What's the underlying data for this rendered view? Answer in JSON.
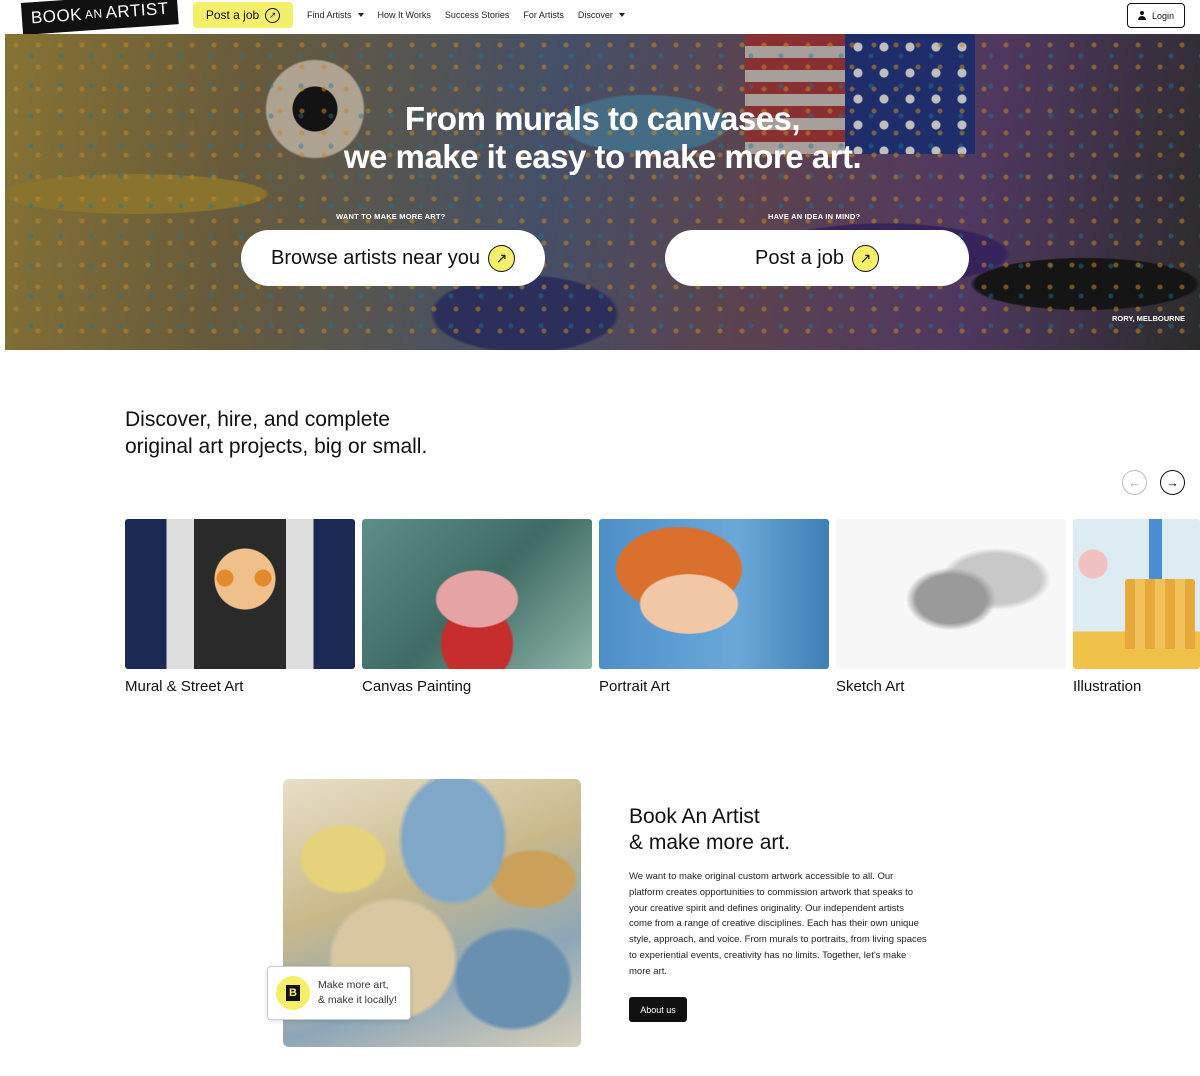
{
  "nav": {
    "logo": {
      "part1": "BOOK",
      "part2": "AN",
      "part3": "ARTIST"
    },
    "post_job": "Post a job",
    "menu": [
      {
        "label": "Find Artists",
        "dropdown": true
      },
      {
        "label": "How It Works",
        "dropdown": false
      },
      {
        "label": "Success Stories",
        "dropdown": false
      },
      {
        "label": "For Artists",
        "dropdown": false
      },
      {
        "label": "Discover",
        "dropdown": true
      }
    ],
    "login": "Login"
  },
  "hero": {
    "title_line1": "From murals to canvases,",
    "title_line2": "we make it easy to make more art.",
    "left_label": "WANT TO MAKE MORE ART?",
    "left_button": "Browse artists near you",
    "right_label": "HAVE AN IDEA IN MIND?",
    "right_button": "Post a job",
    "credit": "RORY, MELBOURNE"
  },
  "discover": {
    "title_line1": "Discover, hire, and complete",
    "title_line2": "original art projects, big or small.",
    "categories": [
      {
        "label": "Mural & Street Art"
      },
      {
        "label": "Canvas Painting"
      },
      {
        "label": "Portrait Art"
      },
      {
        "label": "Sketch Art"
      },
      {
        "label": "Illustration"
      }
    ]
  },
  "about": {
    "badge_logo": "B",
    "badge_line1": "Make more art,",
    "badge_line2": "& make it locally!",
    "title_line1": "Book An Artist",
    "title_line2": "& make more art.",
    "body": "We want to make original custom artwork accessible to all. Our platform creates opportunities to commission artwork that speaks to your creative spirit and defines originality. Our independent artists come from a range of creative disciplines. Each has their own unique style, approach, and voice. From murals to portraits, from living spaces to experiential events, creativity has no limits. Together, let's make more art.",
    "button": "About us"
  },
  "colors": {
    "accent_yellow": "#f4ef6b",
    "dark": "#111111"
  },
  "icons": [
    "arrow-up-right-icon",
    "chevron-down-icon",
    "user-icon",
    "arrow-left-icon",
    "arrow-right-icon"
  ]
}
